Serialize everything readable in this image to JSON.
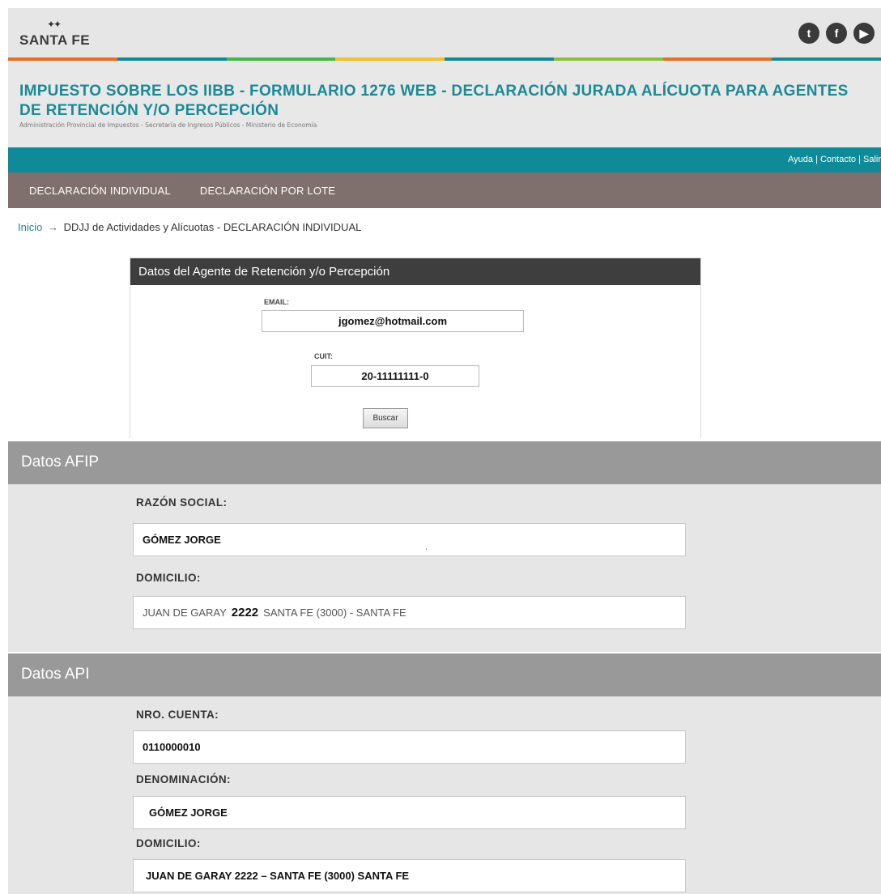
{
  "header": {
    "logo_text": "SANTA FE",
    "social": [
      {
        "icon": "twitter-icon",
        "glyph": "t"
      },
      {
        "icon": "facebook-icon",
        "glyph": "f"
      },
      {
        "icon": "youtube-icon",
        "glyph": "▶"
      }
    ],
    "stripe_colors": [
      "#e36f21",
      "#0f8a98",
      "#45b649",
      "#f2c12e",
      "#0f8a98",
      "#8cbf3f",
      "#e36f21",
      "#1a8a96"
    ]
  },
  "title": {
    "main": "IMPUESTO SOBRE LOS IIBB - FORMULARIO 1276 WEB - DECLARACIÓN JURADA ALÍCUOTA PARA AGENTES DE RETENCIÓN Y/O PERCEPCIÓN",
    "sub": "Administración Provincial de Impuestos - Secretaría de Ingresos Públicos - Ministerio de Economía"
  },
  "toplinks": {
    "help": "Ayuda",
    "contact": "Contacto",
    "logout": "Salir"
  },
  "menu": {
    "individual": "DECLARACIÓN INDIVIDUAL",
    "batch": "DECLARACIÓN POR LOTE"
  },
  "breadcrumb": {
    "home": "Inicio",
    "separator": "→",
    "current": "DDJJ de Actividades y Alícuotas - DECLARACIÓN INDIVIDUAL"
  },
  "agent_panel": {
    "title": "Datos del Agente de Retención y/o Percepción",
    "email_label": "EMAIL:",
    "email_value": "jgomez@hotmail.com",
    "cuit_label": "CUIT:",
    "cuit_value": "20-11111111-0",
    "search_button": "Buscar"
  },
  "afip": {
    "title": "Datos AFIP",
    "razon_label": "RAZÓN SOCIAL:",
    "razon_value": "GÓMEZ JORGE",
    "domicilio_label": "DOMICILIO:",
    "domicilio_street": "JUAN DE GARAY",
    "domicilio_number": "2222",
    "domicilio_rest": "SANTA FE (3000) - SANTA FE"
  },
  "api": {
    "title": "Datos API",
    "cuenta_label": "NRO. CUENTA:",
    "cuenta_value": "0110000010",
    "denominacion_label": "DENOMINACIÓN:",
    "denominacion_value": "GÓMEZ JORGE",
    "domicilio_label": "DOMICILIO:",
    "domicilio_value": "JUAN DE GARAY 2222 – SANTA FE  (3000) SANTA  FE"
  }
}
